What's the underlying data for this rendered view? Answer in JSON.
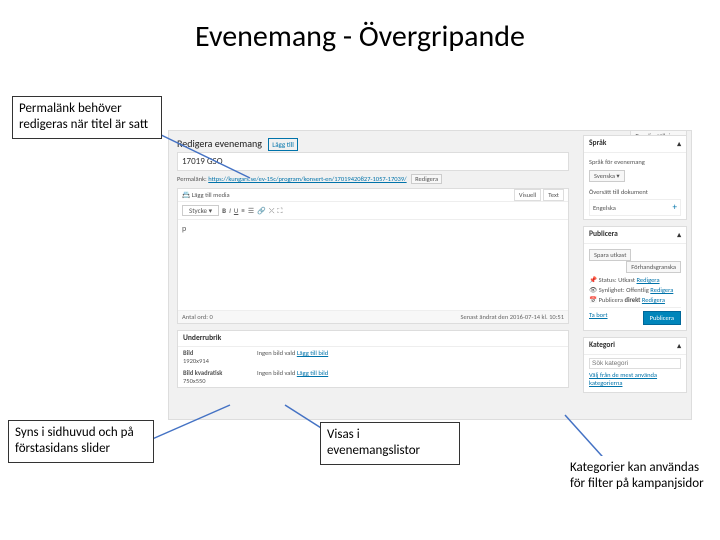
{
  "title": "Evenemang - Övergripande",
  "callouts": {
    "tl": "Permalänk behöver redigeras när titel är satt",
    "bl": "Syns i sidhuvud och på förstasidans slider",
    "bm": "Visas i evenemangslistor",
    "br": "Kategorier kan användas för filter på kampanjsidor"
  },
  "wp": {
    "screen_opts": "Panelinställningar",
    "page_h": "Redigera evenemang",
    "addnew": "Lägg till",
    "post_title": "17019 GSO",
    "permalink_lbl": "Permalänk:",
    "permalink_url": "https://kungars.se/ev-15c/program/konsert-en/17019420827-1057-17039/",
    "permalink_btn": "Redigera",
    "media_btn": "Lägg till media",
    "tab_visual": "Visuell",
    "tab_text": "Text",
    "fmt_style": "Stycke",
    "ed_p": "p",
    "wordcount_lbl": "Antal ord: 0",
    "lastedit": "Senast ändrat den 2016-07-14 kl. 10:51",
    "excerpt_h": "Underrubrik",
    "img_h": "Bild",
    "img_dim": "1920x914",
    "img_none": "Ingen bild vald",
    "img_link": "Lägg till bild",
    "thumb_h": "Bild kvadratisk",
    "thumb_dim": "750x550",
    "side": {
      "lang_h": "Språk",
      "lang_lbl": "Språk för evenemang",
      "lang_val": "Svenska",
      "trans_h": "Översätt till dokument",
      "trans_lang": "Engelska",
      "pub_h": "Publicera",
      "save_draft": "Spara utkast",
      "preview": "Förhandsgranska",
      "status_lbl": "Status:",
      "status_val": "Utkast",
      "status_edit": "Redigera",
      "vis_lbl": "Synlighet:",
      "vis_val": "Offentlig",
      "vis_edit": "Redigera",
      "sched_lbl": "Publicera",
      "sched_val": "direkt",
      "sched_edit": "Redigera",
      "trash": "Ta bort",
      "publish_btn": "Publicera",
      "cat_h": "Kategori",
      "cat_search": "Sök kategori",
      "cat_link": "Välj från de mest använda kategorierna"
    }
  }
}
